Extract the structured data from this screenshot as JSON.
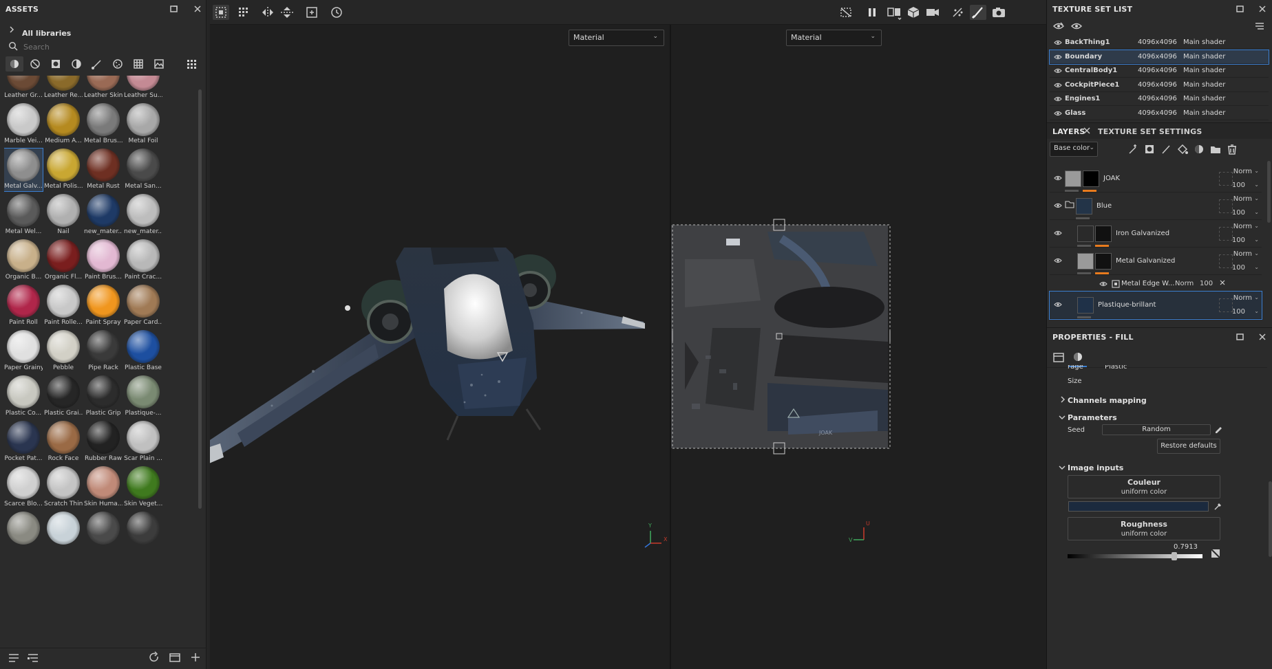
{
  "assets": {
    "title": "ASSETS",
    "breadcrumb": "All libraries",
    "search_placeholder": "Search",
    "materials": [
      {
        "label": "Leather Gr...",
        "color": "#6b4a35"
      },
      {
        "label": "Leather Re...",
        "color": "#8a6a2a"
      },
      {
        "label": "Leather Skin",
        "color": "#9a6a55"
      },
      {
        "label": "Leather Su...",
        "color": "#c48a94"
      },
      {
        "label": "Marble Vei...",
        "color": "#c9c9c9"
      },
      {
        "label": "Medium A...",
        "color": "#b58a20"
      },
      {
        "label": "Metal Brus...",
        "color": "#7a7a7a"
      },
      {
        "label": "Metal Foil",
        "color": "#a8a8a8"
      },
      {
        "label": "Metal Galv...",
        "color": "#8e8e8e",
        "selected": true
      },
      {
        "label": "Metal Polis...",
        "color": "#c9a732"
      },
      {
        "label": "Metal Rust",
        "color": "#6e2f22"
      },
      {
        "label": "Metal San...",
        "color": "#4a4a4a"
      },
      {
        "label": "Metal Wel...",
        "color": "#5a5a5a"
      },
      {
        "label": "Nail",
        "color": "#b0b0b0"
      },
      {
        "label": "new_mater...",
        "color": "#1e3a66"
      },
      {
        "label": "new_mater...",
        "color": "#bdbdbd"
      },
      {
        "label": "Organic B...",
        "color": "#c8b08a"
      },
      {
        "label": "Organic Fl...",
        "color": "#7a1e1e"
      },
      {
        "label": "Paint Brus...",
        "color": "#e2b8d2"
      },
      {
        "label": "Paint Crac...",
        "color": "#b8b8b8"
      },
      {
        "label": "Paint Roll",
        "color": "#b0264a"
      },
      {
        "label": "Paint Rolle...",
        "color": "#c8c8c8"
      },
      {
        "label": "Paint Spray",
        "color": "#f0961e"
      },
      {
        "label": "Paper Card...",
        "color": "#a07a55"
      },
      {
        "label": "Paper Grainy",
        "color": "#e0e0e0"
      },
      {
        "label": "Pebble",
        "color": "#d2d0c6"
      },
      {
        "label": "Pipe Rack",
        "color": "#3a3a3a"
      },
      {
        "label": "Plastic Base",
        "color": "#1d4fa0"
      },
      {
        "label": "Plastic Co...",
        "color": "#c8c8c0"
      },
      {
        "label": "Plastic Grai...",
        "color": "#262626"
      },
      {
        "label": "Plastic Grip",
        "color": "#2c2c2c"
      },
      {
        "label": "Plastique-...",
        "color": "#7a8a72"
      },
      {
        "label": "Pocket Pat...",
        "color": "#2a3550"
      },
      {
        "label": "Rock Face",
        "color": "#9a6a45"
      },
      {
        "label": "Rubber Raw",
        "color": "#222222"
      },
      {
        "label": "Scar Plain ...",
        "color": "#c0c0c0"
      },
      {
        "label": "Scarce Blo...",
        "color": "#d0d0d0"
      },
      {
        "label": "Scratch Thin",
        "color": "#c4c4c4"
      },
      {
        "label": "Skin Huma...",
        "color": "#c08a78"
      },
      {
        "label": "Skin Veget...",
        "color": "#3f7a1e"
      },
      {
        "label": "",
        "color": "#8a8a82"
      },
      {
        "label": "",
        "color": "#c8d2d8"
      },
      {
        "label": "",
        "color": "#4a4a4a"
      },
      {
        "label": "",
        "color": "#3c3c3c"
      }
    ]
  },
  "viewport": {
    "left_dropdown": "Material",
    "right_dropdown": "Material",
    "axis_3d": {
      "x": "X",
      "y": "Y"
    },
    "axis_uv": {
      "u": "U",
      "v": "V"
    }
  },
  "texture_set_list": {
    "title": "TEXTURE SET LIST",
    "rows": [
      {
        "name": "BackThing1",
        "res": "4096x4096",
        "shader": "Main shader"
      },
      {
        "name": "Boundary",
        "res": "4096x4096",
        "shader": "Main shader",
        "selected": true
      },
      {
        "name": "CentralBody1",
        "res": "4096x4096",
        "shader": "Main shader"
      },
      {
        "name": "CockpitPiece1",
        "res": "4096x4096",
        "shader": "Main shader"
      },
      {
        "name": "Engines1",
        "res": "4096x4096",
        "shader": "Main shader"
      },
      {
        "name": "Glass",
        "res": "4096x4096",
        "shader": "Main shader"
      }
    ]
  },
  "layers": {
    "tab_layers": "LAYERS",
    "tab_settings": "TEXTURE SET SETTINGS",
    "channel": "Base color",
    "items": [
      {
        "name": "JOAK",
        "blend": "Norm",
        "opacity": "100"
      },
      {
        "name": "Blue",
        "blend": "Norm",
        "opacity": "100"
      },
      {
        "name": "Iron Galvanized",
        "blend": "Norm",
        "opacity": "100"
      },
      {
        "name": "Metal Galvanized",
        "blend": "Norm",
        "opacity": "100"
      },
      {
        "name": "Metal Edge W...",
        "blend": "Norm",
        "opacity": "100"
      },
      {
        "name": "Plastique-brillant",
        "blend": "Norm",
        "opacity": "100"
      }
    ]
  },
  "properties": {
    "title": "PROPERTIES - FILL",
    "cut_row_1": "rage",
    "cut_row_2": "Plastic",
    "size_label": "Size",
    "channels_mapping": "Channels mapping",
    "parameters": "Parameters",
    "seed_label": "Seed",
    "seed_value": "Random",
    "restore_defaults": "Restore defaults",
    "image_inputs": "Image inputs",
    "couleur_title": "Couleur",
    "couleur_sub": "uniform color",
    "roughness_title": "Roughness",
    "roughness_sub": "uniform color",
    "roughness_value": "0.7913",
    "swatch_color": "#1b2a3e"
  }
}
